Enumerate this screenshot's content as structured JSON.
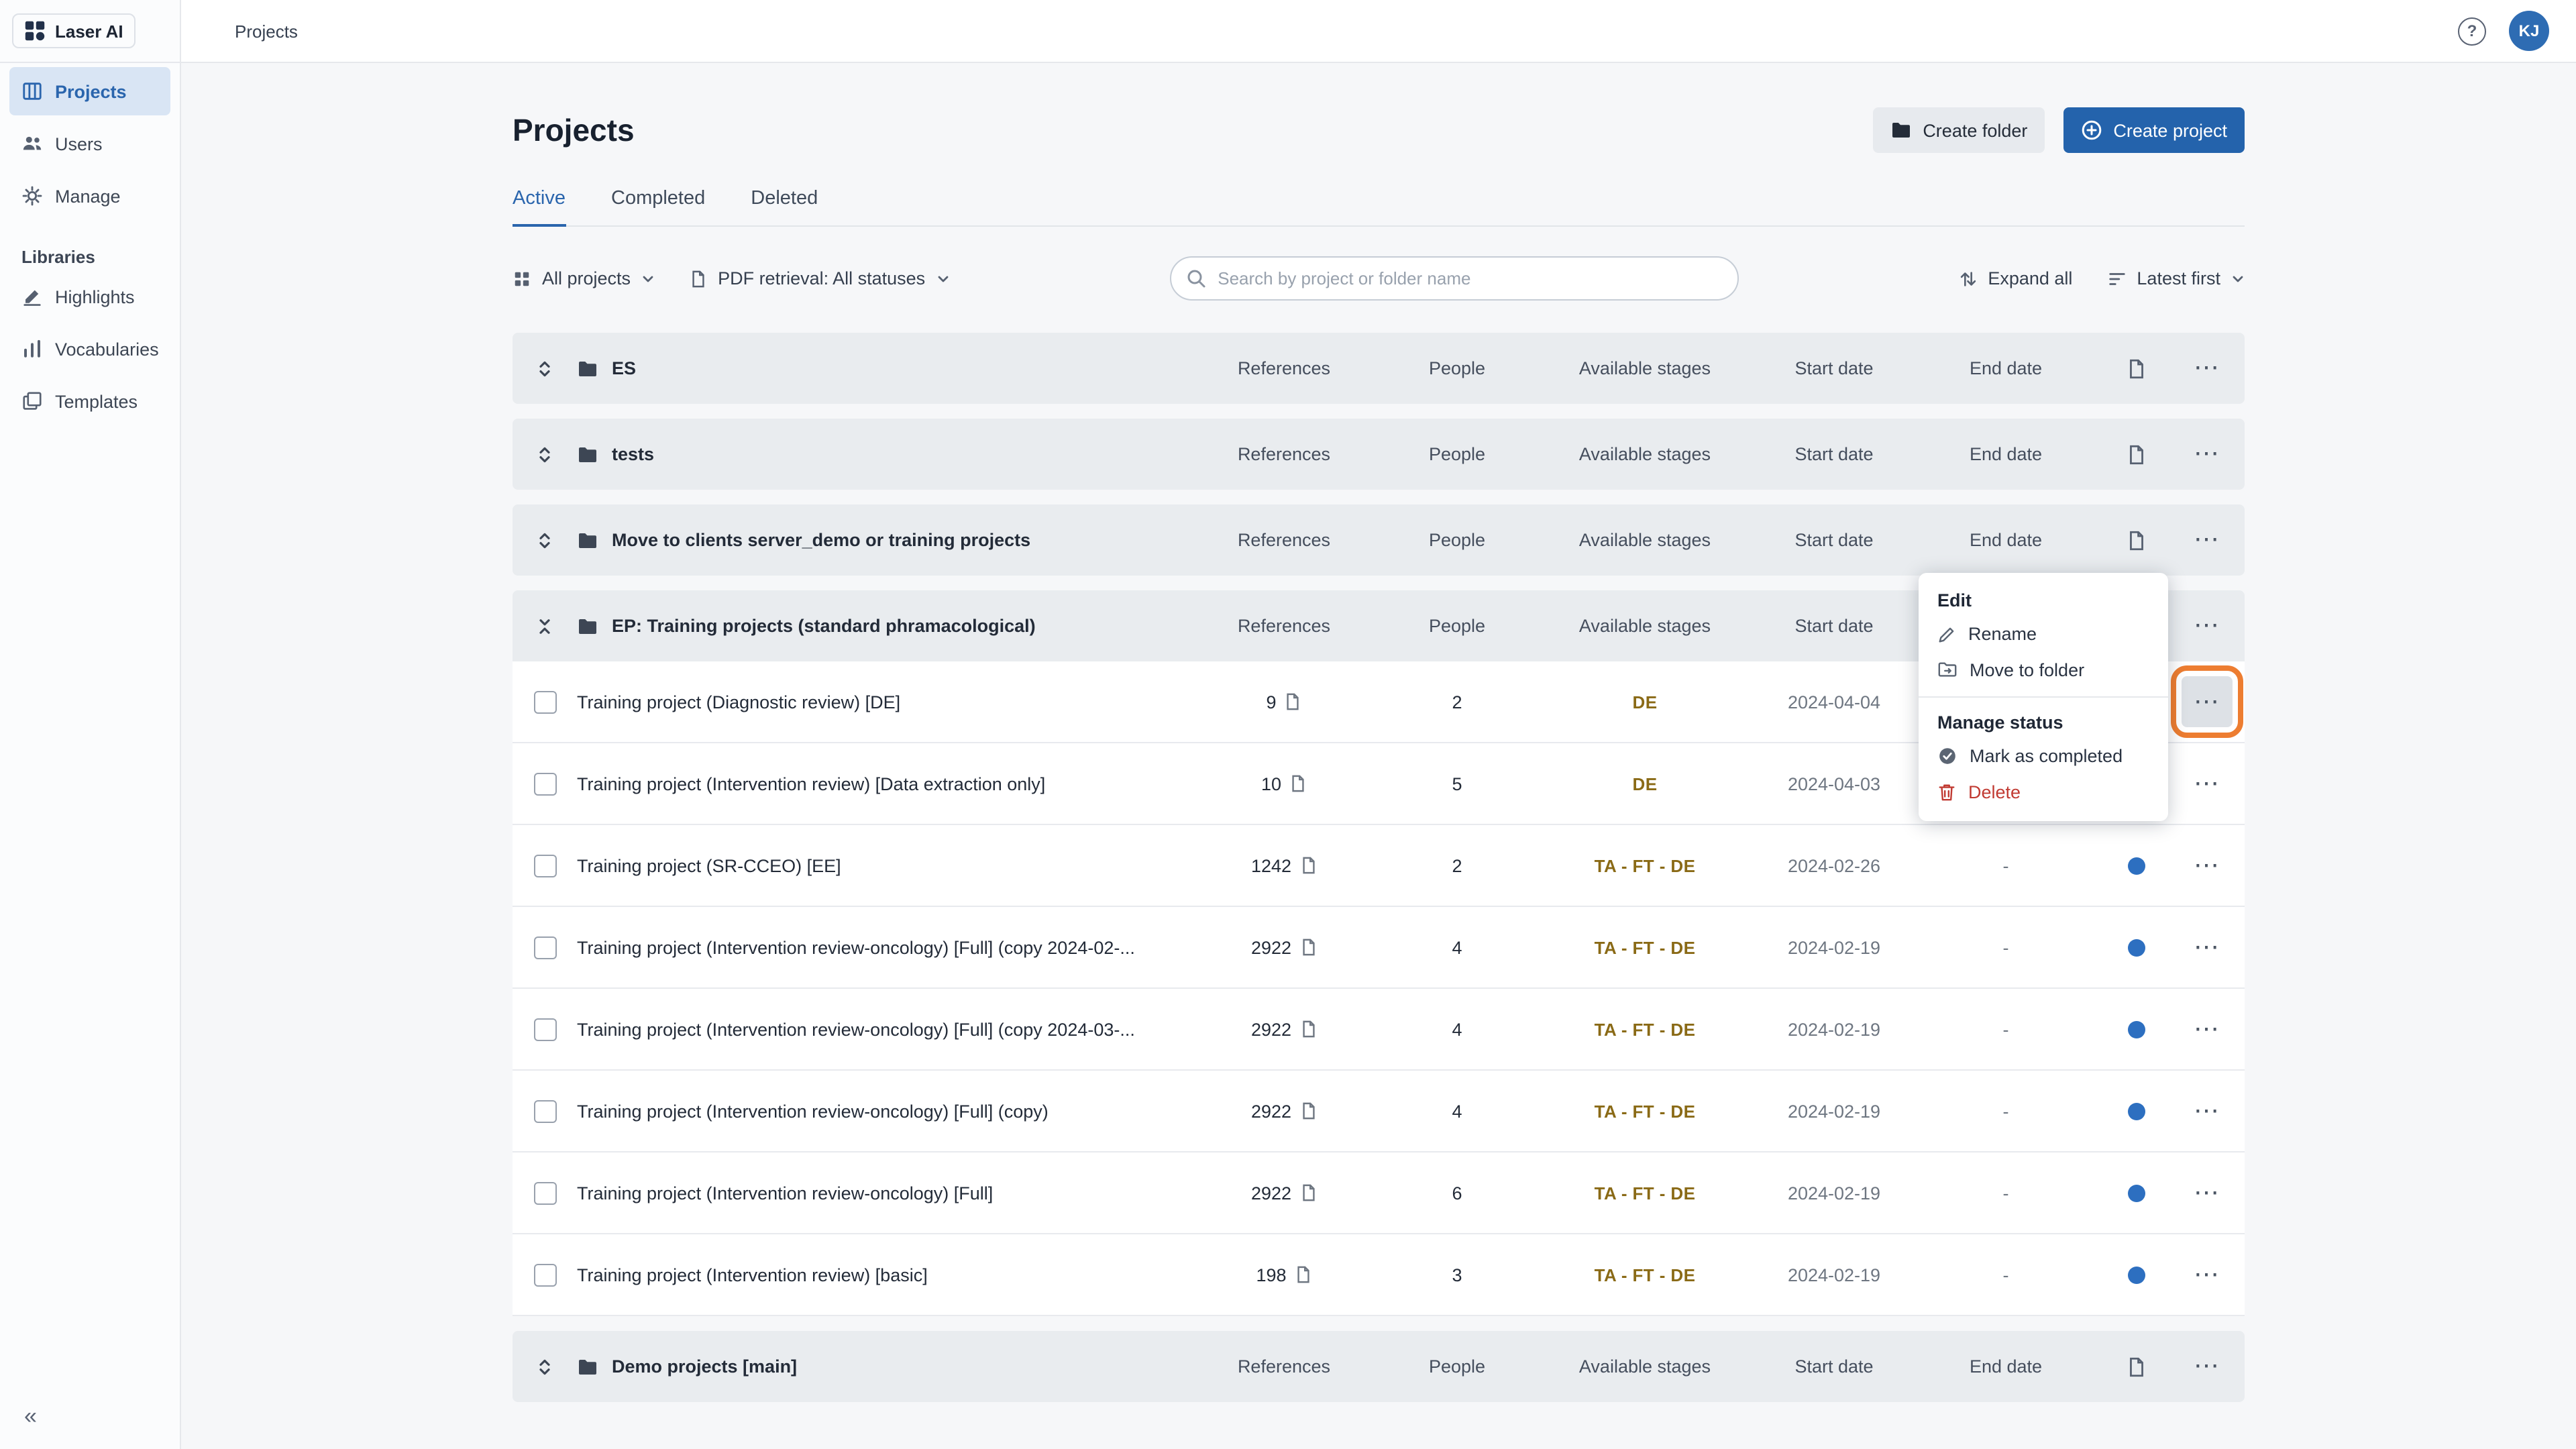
{
  "app": {
    "logo": "Laser AI",
    "breadcrumb": "Projects",
    "avatar": "KJ",
    "help": "?"
  },
  "icons": {
    "ellipsis": "⋯",
    "collapse": "«"
  },
  "sidebar": {
    "items": [
      {
        "label": "Projects",
        "active": true
      },
      {
        "label": "Users"
      },
      {
        "label": "Manage"
      }
    ],
    "section": "Libraries",
    "libraries": [
      {
        "label": "Highlights"
      },
      {
        "label": "Vocabularies"
      },
      {
        "label": "Templates"
      }
    ]
  },
  "page": {
    "title": "Projects",
    "create_folder": "Create folder",
    "create_project": "Create project",
    "tabs": [
      {
        "label": "Active",
        "active": true
      },
      {
        "label": "Completed"
      },
      {
        "label": "Deleted"
      }
    ]
  },
  "filters": {
    "scope": "All projects",
    "pdf": "PDF retrieval: All statuses",
    "search_placeholder": "Search by project or folder name",
    "expand_all": "Expand all",
    "sort": "Latest first"
  },
  "table": {
    "headers": [
      "References",
      "People",
      "Available stages",
      "Start date",
      "End date"
    ],
    "groups": [
      {
        "name": "ES"
      },
      {
        "name": "tests"
      },
      {
        "name": "Move to clients server_demo or training projects"
      },
      {
        "name": "EP: Training projects (standard phramacological)",
        "expanded": true,
        "projects": [
          {
            "name": "Training project (Diagnostic review) [DE]",
            "references": "9",
            "people": "2",
            "stages": "DE",
            "start": "2024-04-04",
            "end": "",
            "dot": false,
            "menu_open": true,
            "highlighted": true
          },
          {
            "name": "Training project (Intervention review) [Data extraction only]",
            "references": "10",
            "people": "5",
            "stages": "DE",
            "start": "2024-04-03",
            "end": "",
            "dot": false
          },
          {
            "name": "Training project (SR-CCEO) [EE]",
            "references": "1242",
            "people": "2",
            "stages": "TA - FT - DE",
            "start": "2024-02-26",
            "end": "-",
            "dot": true
          },
          {
            "name": "Training project (Intervention review-oncology) [Full] (copy 2024-02-...",
            "references": "2922",
            "people": "4",
            "stages": "TA - FT - DE",
            "start": "2024-02-19",
            "end": "-",
            "dot": true
          },
          {
            "name": "Training project (Intervention review-oncology) [Full] (copy 2024-03-...",
            "references": "2922",
            "people": "4",
            "stages": "TA - FT - DE",
            "start": "2024-02-19",
            "end": "-",
            "dot": true
          },
          {
            "name": "Training project (Intervention review-oncology) [Full] (copy)",
            "references": "2922",
            "people": "4",
            "stages": "TA - FT - DE",
            "start": "2024-02-19",
            "end": "-",
            "dot": true
          },
          {
            "name": "Training project (Intervention review-oncology) [Full]",
            "references": "2922",
            "people": "6",
            "stages": "TA - FT - DE",
            "start": "2024-02-19",
            "end": "-",
            "dot": true
          },
          {
            "name": "Training project (Intervention review) [basic]",
            "references": "198",
            "people": "3",
            "stages": "TA - FT - DE",
            "start": "2024-02-19",
            "end": "-",
            "dot": true
          }
        ]
      },
      {
        "name": "Demo projects [main]"
      }
    ]
  },
  "context_menu": {
    "edit_title": "Edit",
    "rename": "Rename",
    "move": "Move to folder",
    "status_title": "Manage status",
    "complete": "Mark as completed",
    "delete": "Delete"
  },
  "colors": {
    "accent_blue": "#2a65ad",
    "primary_button": "#2463ac",
    "stage_text": "#8a6a16",
    "status_dot": "#2d6fc0",
    "danger_red": "#c13a32",
    "highlight_orange": "#ed7d31",
    "selected_sidebar_bg": "#d9e5f4",
    "folder_row_bg": "#e9ecef"
  }
}
